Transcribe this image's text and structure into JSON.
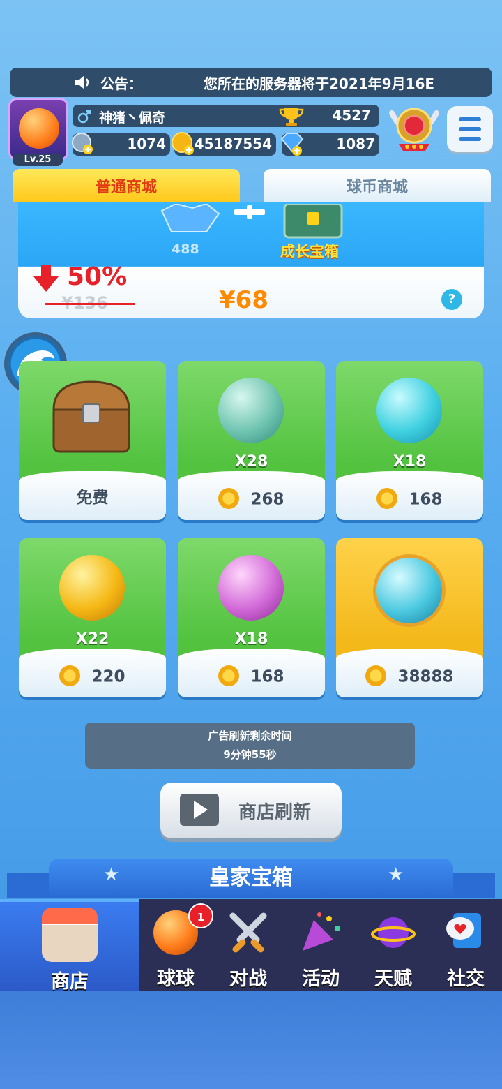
{
  "announcement": {
    "label": "公告：",
    "message": "您所在的服务器将于2021年9月16E"
  },
  "player": {
    "level": "Lv.25",
    "name": "神猪丶佩奇",
    "trophies": "4527"
  },
  "resources": {
    "energy": "1074",
    "coins": "45187554",
    "gems": "1087"
  },
  "tabs": [
    {
      "label": "普通商城"
    },
    {
      "label": "球币商城"
    }
  ],
  "banner": {
    "gem_count": "488",
    "chest_label": "成长宝箱",
    "discount": "50%",
    "original_price": "¥136",
    "price": "¥68",
    "help": "?"
  },
  "shop_items": [
    {
      "qty": "",
      "price": "免费"
    },
    {
      "qty": "X28",
      "price": "268"
    },
    {
      "qty": "X18",
      "price": "168"
    },
    {
      "qty": "X22",
      "price": "220"
    },
    {
      "qty": "X18",
      "price": "168"
    },
    {
      "qty": "",
      "price": "38888"
    }
  ],
  "ad_refresh": {
    "title": "广告刷新剩余时间",
    "time": "9分钟55秒"
  },
  "refresh_button": {
    "label": "商店刷新"
  },
  "royal_chest": {
    "title": "皇家宝箱"
  },
  "bottom_nav": [
    {
      "label": "商店"
    },
    {
      "label": "球球",
      "badge": "1"
    },
    {
      "label": "对战"
    },
    {
      "label": "活动"
    },
    {
      "label": "天赋"
    },
    {
      "label": "社交"
    }
  ]
}
